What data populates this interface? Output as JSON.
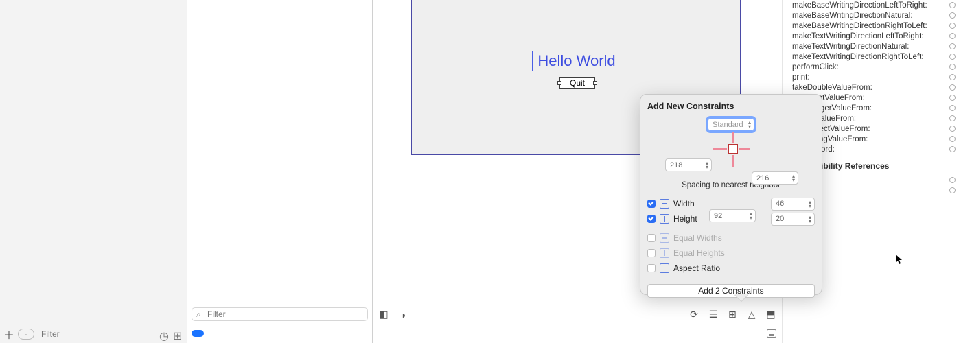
{
  "left": {
    "filter_placeholder": "Filter"
  },
  "mid": {
    "filter_placeholder": "Filter"
  },
  "canvas": {
    "hello_text": "Hello World",
    "quit_label": "Quit"
  },
  "popover": {
    "title": "Add New Constraints",
    "top_value": "Standard",
    "left_value": "218",
    "right_value": "216",
    "bottom_value": "92",
    "spacing_label": "Spacing to nearest neighbor",
    "width_label": "Width",
    "width_value": "46",
    "height_label": "Height",
    "height_value": "20",
    "equal_widths_label": "Equal Widths",
    "equal_heights_label": "Equal Heights",
    "aspect_ratio_label": "Aspect Ratio",
    "add_button_label": "Add 2 Constraints"
  },
  "inspector": {
    "methods": [
      "makeBaseWritingDirectionLeftToRight:",
      "makeBaseWritingDirectionNatural:",
      "makeBaseWritingDirectionRightToLeft:",
      "makeTextWritingDirectionLeftToRight:",
      "makeTextWritingDirectionNatural:",
      "makeTextWritingDirectionRightToLeft:",
      "performClick:",
      "print:",
      "takeDoubleValueFrom:",
      "takeFloatValueFrom:",
      "takeIntegerValueFrom:",
      "takeIntValueFrom:",
      "takeObjectValueFrom:",
      "takeStringValueFrom:",
      "toggleWord:"
    ],
    "section_header": "Accessibility References"
  }
}
